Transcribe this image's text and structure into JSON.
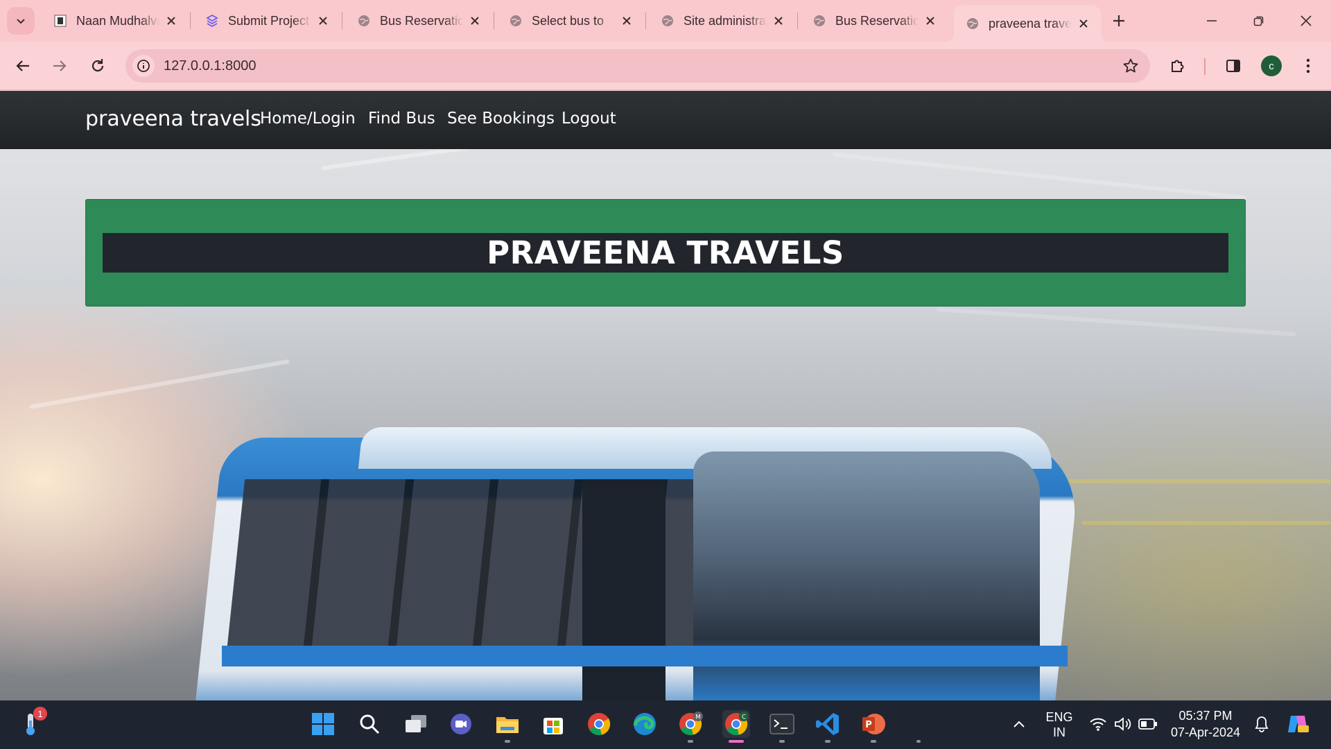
{
  "browser": {
    "tabs": [
      {
        "title": "Naan Mudhalvan",
        "icon": "college-icon"
      },
      {
        "title": "Submit Project",
        "icon": "stack-icon"
      },
      {
        "title": "Bus Reservation",
        "icon": "globe-icon"
      },
      {
        "title": "Select bus to",
        "icon": "globe-icon"
      },
      {
        "title": "Site administration",
        "icon": "globe-icon"
      },
      {
        "title": "Bus Reservation",
        "icon": "globe-icon"
      },
      {
        "title": "praveena travels",
        "icon": "globe-icon",
        "active": true
      }
    ],
    "url": "127.0.0.1:8000",
    "profile_initial": "c"
  },
  "site": {
    "brand": "praveena travels",
    "nav": [
      "Home/Login",
      "Find Bus",
      "See Bookings",
      "Logout"
    ],
    "heading": "PRAVEENA TRAVELS",
    "colors": {
      "nav_bg": "#212529",
      "box_green": "#2e8a57",
      "heading_bar": "#22262c"
    }
  },
  "taskbar": {
    "notification_count": "1",
    "language": [
      "ENG",
      "IN"
    ],
    "time": "05:37 PM",
    "date": "07-Apr-2024",
    "profile_badges": [
      "M",
      "C"
    ]
  }
}
